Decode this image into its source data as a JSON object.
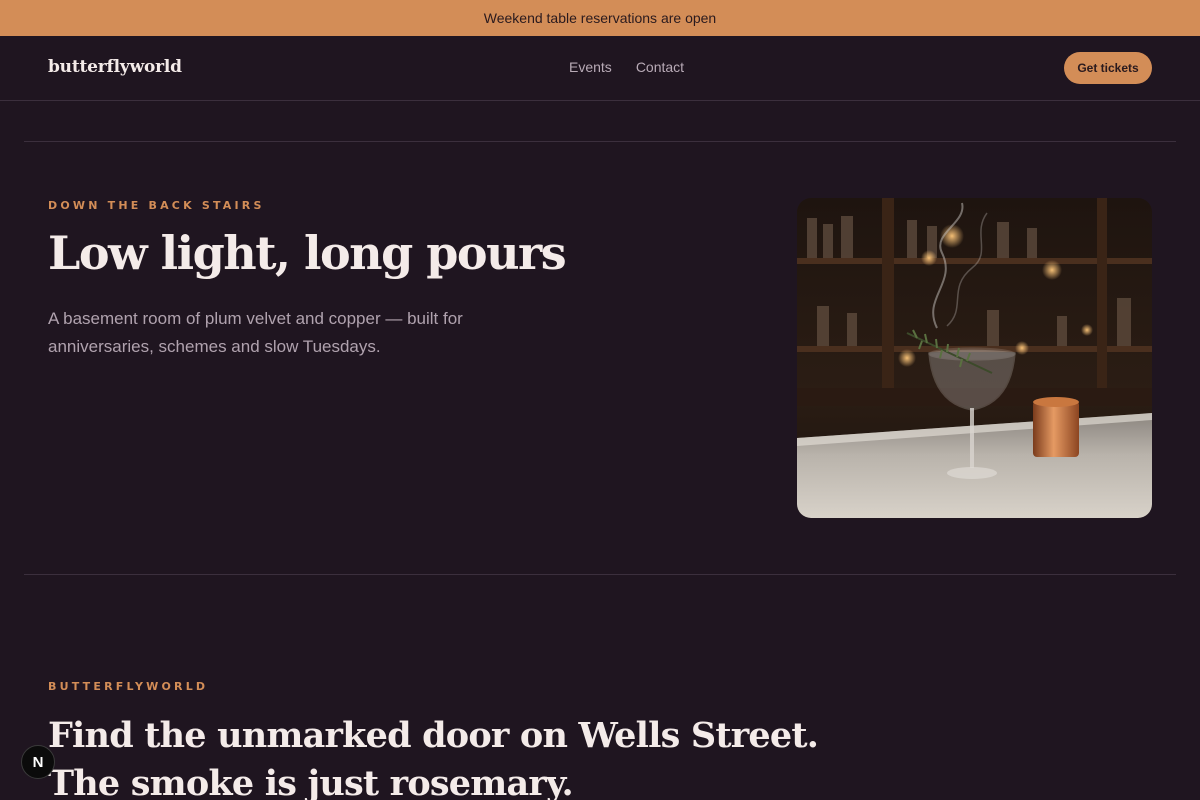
{
  "announcement": {
    "text": "Weekend table reservations are open"
  },
  "header": {
    "logo": "butterflyworld",
    "nav": [
      {
        "label": "Events"
      },
      {
        "label": "Contact"
      }
    ],
    "cta_label": "Get tickets"
  },
  "hero": {
    "eyebrow": "DOWN THE BACK STAIRS",
    "title": "Low light, long pours",
    "subtitle": "A basement room of plum velvet and copper — built for anniversaries, schemes and slow Tuesdays."
  },
  "second": {
    "eyebrow": "BUTTERFLYWORLD",
    "title_line1": "Find the unmarked door on Wells Street.",
    "title_line2": "The smoke is just rosemary."
  },
  "badge": {
    "letter": "N"
  },
  "colors": {
    "background": "#1f1520",
    "accent": "#d38d57",
    "text": "#f4ebe9",
    "muted": "#b0a2ae"
  }
}
